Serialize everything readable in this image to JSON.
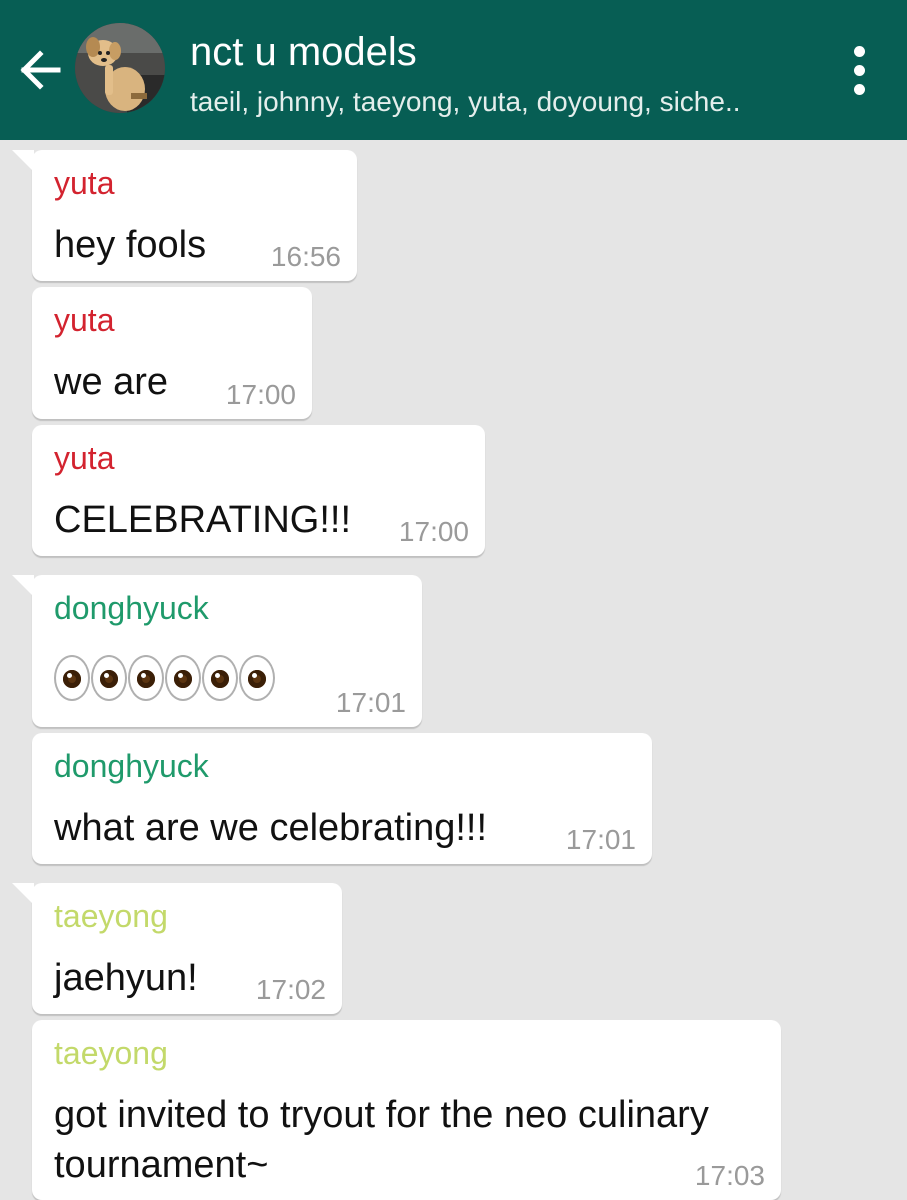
{
  "header": {
    "title": "nct u models",
    "members": "taeil, johnny, taeyong, yuta, doyoung, siche..",
    "back_icon": "arrow-left-icon",
    "menu_icon": "more-vertical-icon",
    "background_color": "#075e54"
  },
  "sender_colors": {
    "yuta": "#d3232f",
    "donghyuck": "#1f9a6b",
    "taeyong": "#c3d96a"
  },
  "messages": [
    {
      "sender": "yuta",
      "text": "hey fools",
      "time": "16:56"
    },
    {
      "sender": "yuta",
      "text": "we are",
      "time": "17:00"
    },
    {
      "sender": "yuta",
      "text": "CELEBRATING!!!",
      "time": "17:00"
    },
    {
      "sender": "donghyuck",
      "text": "👀👀👀",
      "emoji_icon": "eyes-emoji-icon",
      "time": "17:01"
    },
    {
      "sender": "donghyuck",
      "text": "what are we celebrating!!!",
      "time": "17:01"
    },
    {
      "sender": "taeyong",
      "text": "jaehyun!",
      "time": "17:02"
    },
    {
      "sender": "taeyong",
      "text_line_1": "got invited to tryout for the neo culinary",
      "text_line_2": "tournament~",
      "time": "17:03"
    }
  ]
}
